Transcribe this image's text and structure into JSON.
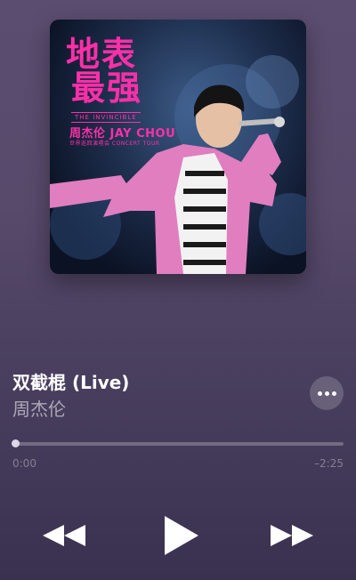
{
  "album_art": {
    "title_line1": "地表",
    "title_line2": "最强",
    "tagline": "THE INVINCIBLE",
    "artist_name": "周杰伦 JAY CHOU",
    "tour": "世界巡回演唱会 CONCERT TOUR"
  },
  "track": {
    "title": "双截棍 (Live)",
    "artist": "周杰伦"
  },
  "more_icon": "ellipsis-icon",
  "playback": {
    "elapsed": "0:00",
    "remaining": "–2:25",
    "progress": 0
  },
  "controls": {
    "rewind_icon": "rewind-icon",
    "play_icon": "play-icon",
    "forward_icon": "fast-forward-icon"
  },
  "colors": {
    "background_top": "#5b4d70",
    "background_bottom": "#3a3150",
    "album_text": "#ff2fa8",
    "jacket": "#e07ec0"
  }
}
